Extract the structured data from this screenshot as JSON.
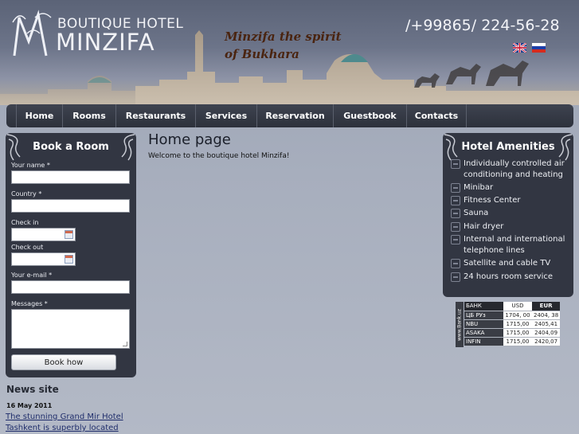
{
  "header": {
    "logo_top": "BOUTIQUE HOTEL",
    "logo_name": "MINZIFA",
    "tagline_line1": "Minzifa the spirit",
    "tagline_line2": "of Bukhara",
    "phone": "/+99865/ 224-56-28"
  },
  "nav": {
    "items": [
      {
        "label": "Home"
      },
      {
        "label": "Rooms"
      },
      {
        "label": "Restaurants"
      },
      {
        "label": "Services"
      },
      {
        "label": "Reservation"
      },
      {
        "label": "Guestbook"
      },
      {
        "label": "Contacts"
      }
    ]
  },
  "booking": {
    "title": "Book a Room",
    "name_label": "Your name *",
    "country_label": "Country *",
    "checkin_label": "Check in",
    "checkout_label": "Check out",
    "email_label": "Your e-mail *",
    "messages_label": "Messages *",
    "submit_label": "Book how"
  },
  "main": {
    "title": "Home page",
    "welcome": "Welcome to the boutique hotel Minzifa!"
  },
  "amenities": {
    "title": "Hotel Amenities",
    "items": [
      {
        "label": "Individually controlled air conditioning and heating",
        "icon": "air-conditioning-icon"
      },
      {
        "label": "Minibar",
        "icon": "minibar-icon"
      },
      {
        "label": "Fitness Center",
        "icon": "fitness-icon"
      },
      {
        "label": "Sauna",
        "icon": "sauna-icon"
      },
      {
        "label": "Hair dryer",
        "icon": "hair-dryer-icon"
      },
      {
        "label": "Internal and international telephone lines",
        "icon": "telephone-icon"
      },
      {
        "label": "Satellite and cable TV",
        "icon": "tv-icon"
      },
      {
        "label": "24 hours room service",
        "icon": "room-service-icon"
      }
    ]
  },
  "news": {
    "title": "News site",
    "date": "16 May 2011",
    "link_line1": "The stunning Grand Mir Hotel",
    "link_line2": "Tashkent is superbly located"
  },
  "rates": {
    "side_label": "www.Bank.uz",
    "header": {
      "bank": "БАНК",
      "usd": "USD",
      "eur": "EUR"
    },
    "rows": [
      {
        "bank": "ЦБ РУз",
        "usd": "1704, 00",
        "eur": "2404, 38"
      },
      {
        "bank": "NBU",
        "usd": "1715,00",
        "eur": "2405,41"
      },
      {
        "bank": "ASAKA",
        "usd": "1715,00",
        "eur": "2404,09"
      },
      {
        "bank": "INFIN",
        "usd": "1715,00",
        "eur": "2420,07"
      }
    ]
  },
  "colors": {
    "panel": "#323642",
    "nav": "#2d313b",
    "link": "#1f2d6b",
    "tagline": "#4a2410"
  }
}
